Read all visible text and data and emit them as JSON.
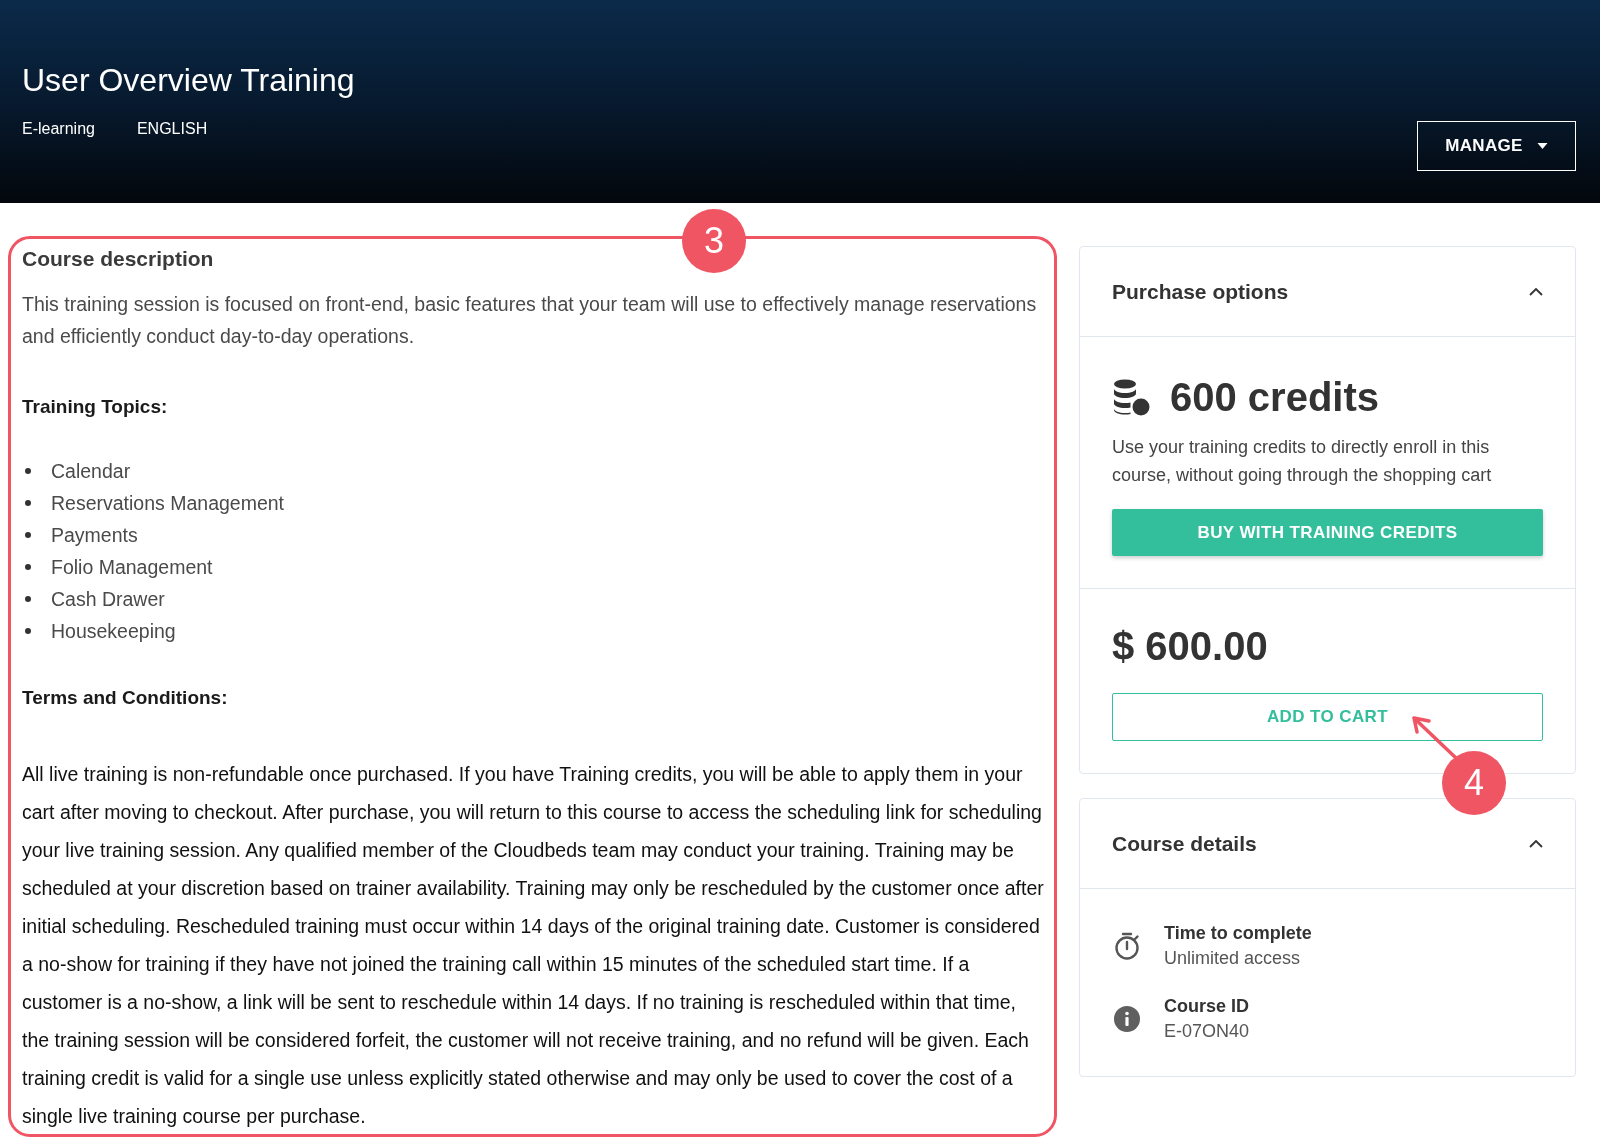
{
  "header": {
    "title": "User Overview Training",
    "meta": [
      "E-learning",
      "ENGLISH"
    ],
    "manage_button": "MANAGE"
  },
  "description": {
    "heading": "Course description",
    "intro": "This training session is focused on front-end, basic features that your team will use to effectively manage reservations and efficiently conduct day-to-day operations.",
    "topics_heading": "Training Topics:",
    "topics": [
      "Calendar",
      "Reservations Management",
      "Payments",
      "Folio Management",
      "Cash Drawer",
      "Housekeeping"
    ],
    "terms_heading": "Terms and Conditions:",
    "terms": "All live training is non-refundable once purchased. If you have Training credits, you will be able to apply them in your cart after moving to checkout. After purchase, you will return to this course to access the scheduling link for scheduling your live training session. Any qualified member of the Cloudbeds team may conduct your training. Training may be scheduled at your discretion based on trainer availability. Training may only be rescheduled by the customer once after initial scheduling. Rescheduled training must occur within 14 days of the original training date. Customer is considered a no-show for training if they have not joined the training call within 15 minutes of the scheduled start time. If a customer is a no-show, a link will be sent to reschedule within 14 days. If no training is rescheduled within that time, the training session will be considered forfeit, the customer will not receive training, and no refund will be given. Each training credit is valid for a single use unless explicitly stated otherwise and may only be used to cover the cost of a single live training course per purchase.",
    "annotation": {
      "kind": "outline",
      "label": "3"
    }
  },
  "purchase_options": {
    "title": "Purchase options",
    "expanded": true,
    "credits": "600 credits",
    "credits_note": "Use your training credits to directly enroll in this course, without going through the shopping cart",
    "buy_button": "BUY WITH TRAINING CREDITS",
    "price": "$ 600.00",
    "cart_button": "ADD TO CART",
    "annotation": {
      "kind": "arrow",
      "label": "4"
    }
  },
  "course_details": {
    "title": "Course details",
    "expanded": true,
    "items": [
      {
        "kind": "time",
        "label": "Time to complete",
        "value": "Unlimited access"
      },
      {
        "kind": "info",
        "label": "Course ID",
        "value": "E-07ON40"
      }
    ]
  }
}
